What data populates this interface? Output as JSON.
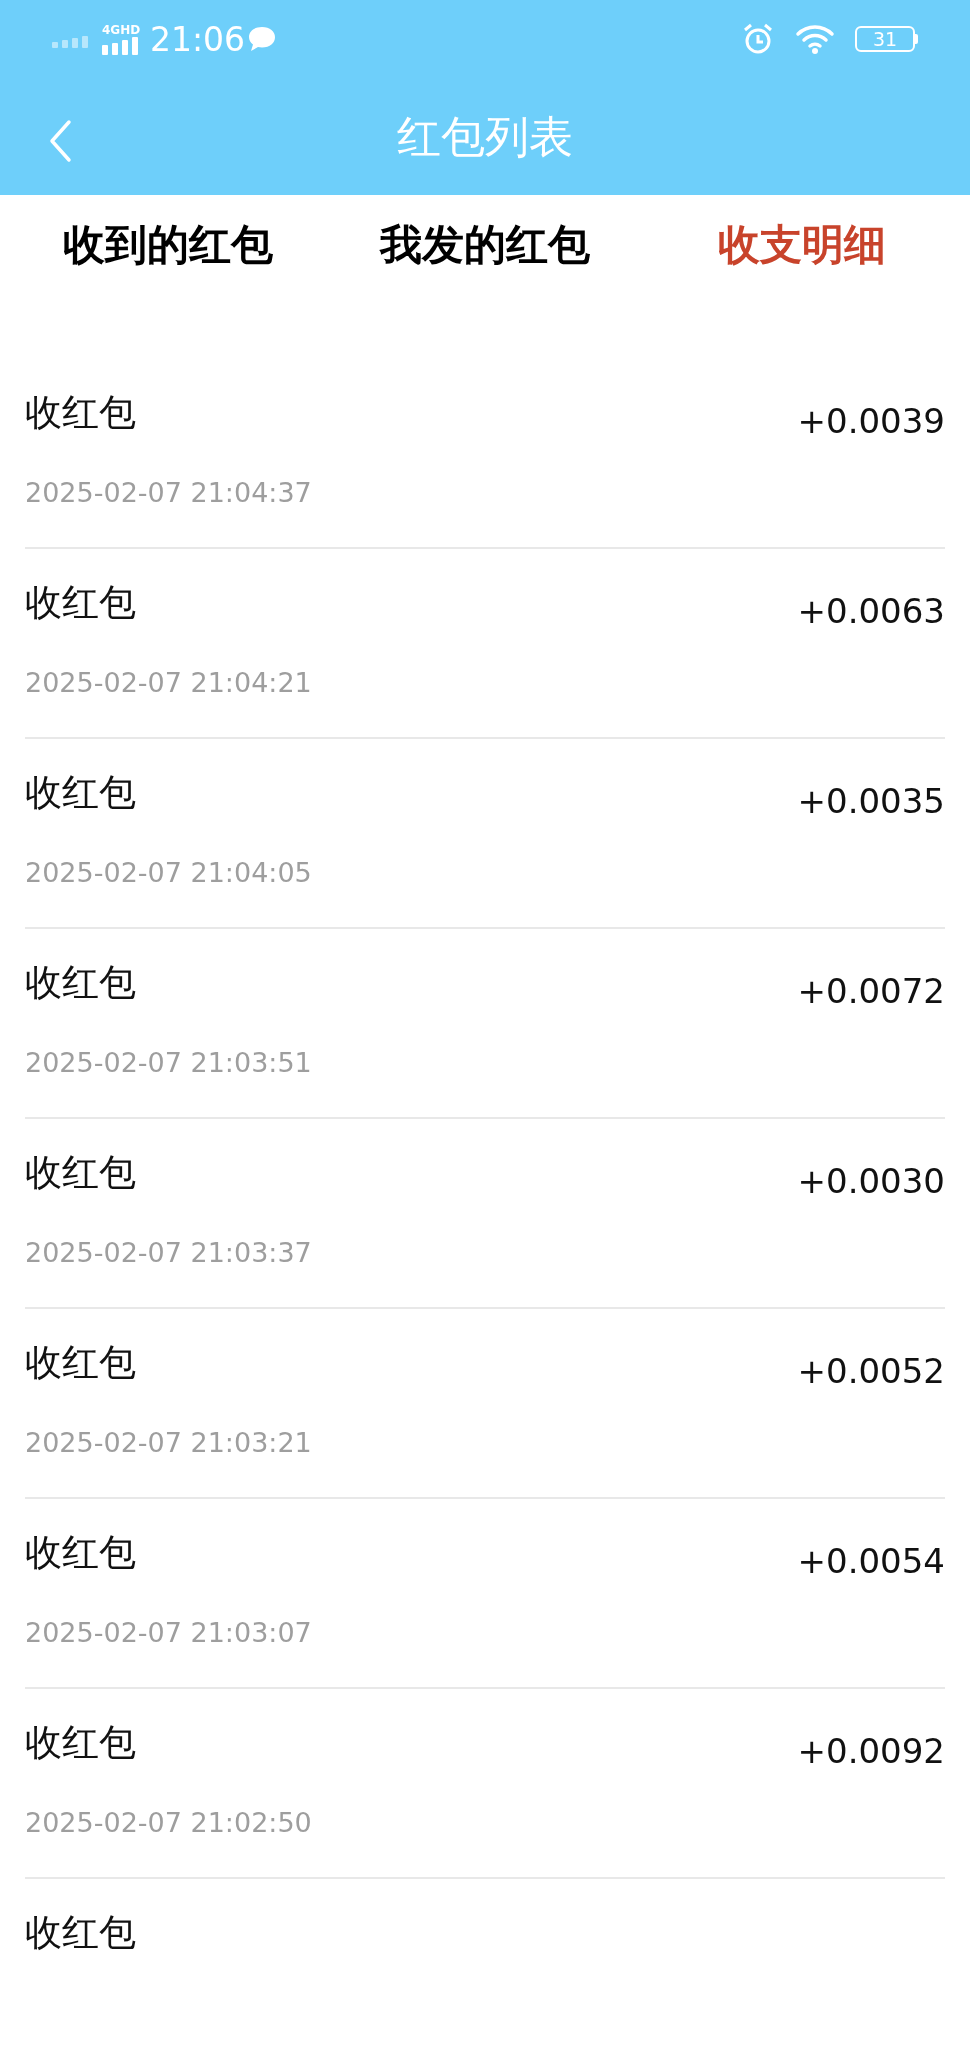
{
  "status_bar": {
    "network": "4GHD",
    "time": "21:06",
    "battery": "31"
  },
  "header": {
    "title": "红包列表"
  },
  "tabs": [
    {
      "label": "收到的红包",
      "selected": false
    },
    {
      "label": "我发的红包",
      "selected": false
    },
    {
      "label": "收支明细",
      "selected": true
    }
  ],
  "records": [
    {
      "title": "收红包",
      "amount": "+0.0039",
      "time": "2025-02-07 21:04:37"
    },
    {
      "title": "收红包",
      "amount": "+0.0063",
      "time": "2025-02-07 21:04:21"
    },
    {
      "title": "收红包",
      "amount": "+0.0035",
      "time": "2025-02-07 21:04:05"
    },
    {
      "title": "收红包",
      "amount": "+0.0072",
      "time": "2025-02-07 21:03:51"
    },
    {
      "title": "收红包",
      "amount": "+0.0030",
      "time": "2025-02-07 21:03:37"
    },
    {
      "title": "收红包",
      "amount": "+0.0052",
      "time": "2025-02-07 21:03:21"
    },
    {
      "title": "收红包",
      "amount": "+0.0054",
      "time": "2025-02-07 21:03:07"
    },
    {
      "title": "收红包",
      "amount": "+0.0092",
      "time": "2025-02-07 21:02:50"
    },
    {
      "title": "收红包"
    }
  ]
}
